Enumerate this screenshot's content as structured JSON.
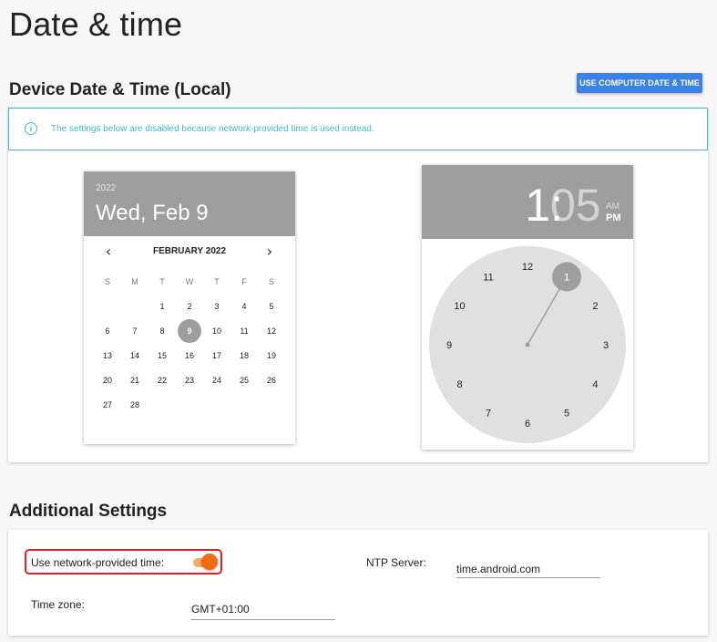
{
  "page": {
    "title": "Date & time"
  },
  "device_section": {
    "title": "Device Date & Time (Local)",
    "use_computer_button": "USE COMPUTER DATE & TIME",
    "info_text": "The settings below are disabled because network-provided time is used instead."
  },
  "calendar": {
    "year": "2022",
    "selected_date": "Wed, Feb 9",
    "month_label": "FEBRUARY 2022",
    "weekdays": [
      "S",
      "M",
      "T",
      "W",
      "T",
      "F",
      "S"
    ],
    "weeks": [
      [
        "",
        "",
        "1",
        "2",
        "3",
        "4",
        "5"
      ],
      [
        "6",
        "7",
        "8",
        "9",
        "10",
        "11",
        "12"
      ],
      [
        "13",
        "14",
        "15",
        "16",
        "17",
        "18",
        "19"
      ],
      [
        "20",
        "21",
        "22",
        "23",
        "24",
        "25",
        "26"
      ],
      [
        "27",
        "28",
        "",
        "",
        "",
        "",
        ""
      ]
    ],
    "selected_day": "9"
  },
  "clock": {
    "hour": "1",
    "separator": ":",
    "minute": "05",
    "am": "AM",
    "pm": "PM",
    "selected_number": "1",
    "numbers": [
      "12",
      "1",
      "2",
      "3",
      "4",
      "5",
      "6",
      "7",
      "8",
      "9",
      "10",
      "11"
    ],
    "hand_value": 1
  },
  "additional_section": {
    "title": "Additional Settings",
    "network_time_label": "Use network-provided time:",
    "network_time_enabled": true,
    "ntp_label": "NTP Server:",
    "ntp_value": "time.android.com",
    "timezone_label": "Time zone:",
    "timezone_value": "GMT+01:00"
  },
  "colors": {
    "accent": "#3b82e6",
    "info": "#3fb9d1",
    "toggle_on": "#f26a12",
    "highlight": "#e02020",
    "header_gray": "#9e9e9e"
  }
}
